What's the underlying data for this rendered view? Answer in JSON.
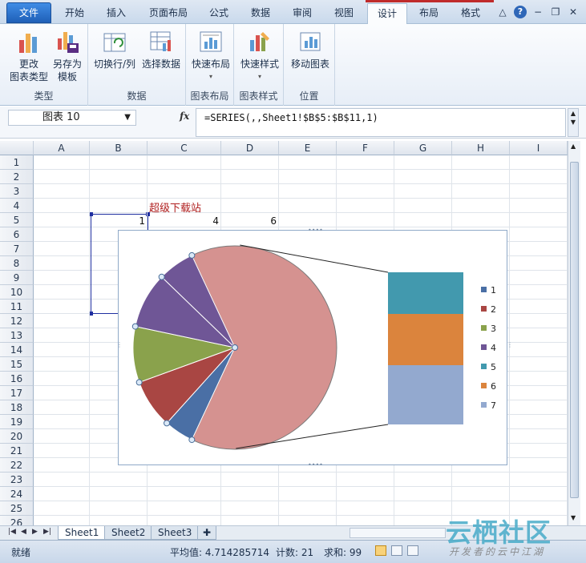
{
  "ribbon_tabs": [
    {
      "label": "文件"
    },
    {
      "label": "开始"
    },
    {
      "label": "插入"
    },
    {
      "label": "页面布局"
    },
    {
      "label": "公式"
    },
    {
      "label": "数据"
    },
    {
      "label": "审阅"
    },
    {
      "label": "视图"
    },
    {
      "label": "设计"
    },
    {
      "label": "布局"
    },
    {
      "label": "格式"
    }
  ],
  "window_controls": [
    "△",
    "?",
    "−",
    "❐",
    "✕"
  ],
  "groups": {
    "type": {
      "label": "类型",
      "btn1_l1": "更改",
      "btn1_l2": "图表类型",
      "btn2_l1": "另存为",
      "btn2_l2": "模板"
    },
    "data": {
      "label": "数据",
      "btn1": "切换行/列",
      "btn2": "选择数据"
    },
    "layout": {
      "label": "图表布局",
      "btn1": "快速布局"
    },
    "style": {
      "label": "图表样式",
      "btn1": "快速样式"
    },
    "location": {
      "label": "位置",
      "btn1": "移动图表"
    }
  },
  "formula_bar": {
    "name_box": "图表 10",
    "fx": "fx",
    "formula": "=SERIES(,,Sheet1!$B$5:$B$11,1)"
  },
  "columns": [
    "A",
    "B",
    "C",
    "D",
    "E",
    "F",
    "G",
    "H",
    "I"
  ],
  "rows": [
    "1",
    "2",
    "3",
    "4",
    "5",
    "6",
    "7",
    "8",
    "9",
    "10",
    "11",
    "12",
    "13",
    "14",
    "15",
    "16",
    "17",
    "18",
    "19",
    "20",
    "21",
    "22",
    "23",
    "24",
    "25",
    "26"
  ],
  "cells": {
    "b5": "1",
    "c5": "4",
    "d5": "6",
    "red_label": "超级下载站"
  },
  "chart_data": {
    "type": "pie",
    "subtype": "bar-of-pie",
    "categories": [
      "1",
      "2",
      "3",
      "4",
      "5",
      "6",
      "7"
    ],
    "legend": [
      "1",
      "2",
      "3",
      "4",
      "5",
      "6",
      "7"
    ],
    "legend_position": "right",
    "colors": [
      "#4a6fa5",
      "#a94643",
      "#8aa24c",
      "#6f5696",
      "#4299ae",
      "#db843d",
      "#93a9cf"
    ],
    "pie_slice_colors": [
      "#4a6fa5",
      "#a94643",
      "#8aa24c",
      "#6f5696",
      "#d59290"
    ],
    "bar_stack_colors": [
      "#4299ae",
      "#db843d",
      "#93a9cf"
    ]
  },
  "sheets": [
    {
      "label": "Sheet1"
    },
    {
      "label": "Sheet2"
    },
    {
      "label": "Sheet3"
    }
  ],
  "status": {
    "ready": "就绪",
    "average": "平均值: 4.714285714",
    "count": "计数: 21",
    "sum": "求和: 99"
  },
  "watermark": {
    "main": "云栖社区",
    "sub": "开发者的云中江湖"
  }
}
